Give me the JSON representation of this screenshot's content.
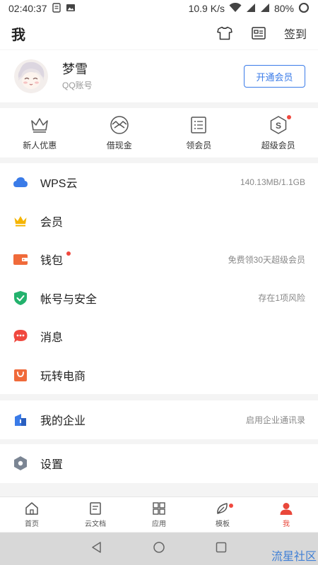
{
  "status_bar": {
    "time": "02:40:37",
    "speed": "10.9 K/s",
    "battery": "80%"
  },
  "header": {
    "title": "我",
    "checkin_label": "签到"
  },
  "profile": {
    "username": "梦雪",
    "account_type": "QQ账号",
    "vip_button": "开通会员"
  },
  "quick_actions": [
    {
      "label": "新人优惠",
      "icon": "crown-outline-icon"
    },
    {
      "label": "借现金",
      "icon": "cash-loan-icon"
    },
    {
      "label": "领会员",
      "icon": "list-card-icon"
    },
    {
      "label": "超级会员",
      "icon": "s-badge-icon",
      "badge": true
    }
  ],
  "menu_group1": [
    {
      "label": "WPS云",
      "value": "140.13MB/1.1GB",
      "icon": "cloud-icon",
      "color": "#3a7be8"
    },
    {
      "label": "会员",
      "value": "",
      "icon": "crown-icon",
      "color": "#f5b400"
    },
    {
      "label": "钱包",
      "value": "免费领30天超级会员",
      "icon": "wallet-icon",
      "color": "#f06a3a",
      "badge": true
    },
    {
      "label": "帐号与安全",
      "value": "存在1项风险",
      "icon": "shield-check-icon",
      "color": "#23b26d"
    },
    {
      "label": "消息",
      "value": "",
      "icon": "chat-bubble-icon",
      "color": "#f0483e"
    },
    {
      "label": "玩转电商",
      "value": "",
      "icon": "shopping-bag-icon",
      "color": "#f06a3a"
    }
  ],
  "menu_group2": [
    {
      "label": "我的企业",
      "value": "启用企业通讯录",
      "icon": "building-icon",
      "color": "#3a7be8"
    }
  ],
  "menu_group3": [
    {
      "label": "设置",
      "value": "",
      "icon": "settings-hex-icon",
      "color": "#7b8593"
    }
  ],
  "bottom_nav": [
    {
      "label": "首页",
      "icon": "home-icon"
    },
    {
      "label": "云文档",
      "icon": "document-icon"
    },
    {
      "label": "应用",
      "icon": "apps-grid-icon"
    },
    {
      "label": "模板",
      "icon": "leaf-icon",
      "badge": true
    },
    {
      "label": "我",
      "icon": "person-icon",
      "active": true
    }
  ],
  "watermark": "流星社区"
}
